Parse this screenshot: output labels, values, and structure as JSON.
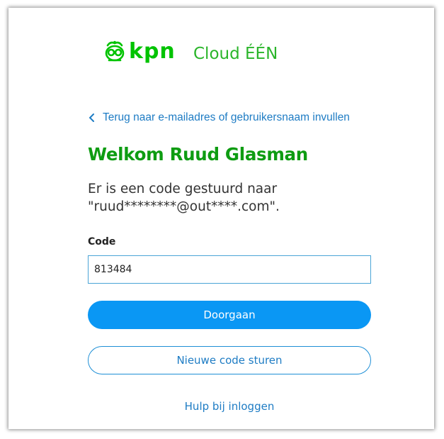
{
  "brand": {
    "logo_text": "kpn",
    "product_name": "Cloud ÉÉN",
    "logo_icon": "kpn-crown-icon",
    "color_green": "#00c300"
  },
  "back_link": {
    "label": "Terug naar e-mailadres of gebruikersnaam invullen",
    "icon": "chevron-left-icon"
  },
  "heading": "Welkom Ruud Glasman",
  "message": "Er is een code gestuurd naar \"ruud********@out****.com\".",
  "code_field": {
    "label": "Code",
    "value": "813484"
  },
  "buttons": {
    "continue_label": "Doorgaan",
    "resend_label": "Nieuwe code sturen"
  },
  "help_link": "Hulp bij inloggen",
  "colors": {
    "accent_blue": "#0a97f4",
    "link_blue": "#1e7cc4",
    "heading_green": "#0e9c12"
  }
}
